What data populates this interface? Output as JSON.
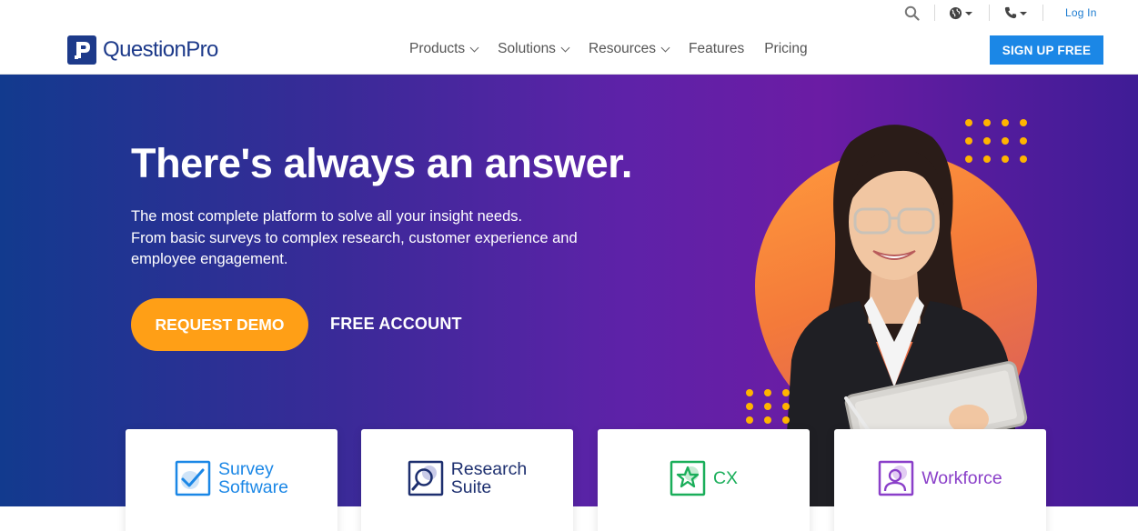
{
  "utility": {
    "search_icon": "search-icon",
    "globe_icon": "globe-icon",
    "phone_icon": "phone-icon",
    "login_label": "Log In"
  },
  "nav": {
    "logo_text": "QuestionPro",
    "menu": [
      {
        "label": "Products"
      },
      {
        "label": "Solutions"
      },
      {
        "label": "Resources"
      },
      {
        "label": "Features"
      },
      {
        "label": "Pricing"
      }
    ],
    "signup_label": "SIGN UP FREE"
  },
  "hero": {
    "title": "There's always an answer.",
    "subtitle_line1": "The most complete platform to solve all your insight needs.",
    "subtitle_line2": "From basic surveys to complex research, customer experience and employee engagement.",
    "cta_primary": "REQUEST DEMO",
    "cta_secondary": "FREE ACCOUNT"
  },
  "cards": [
    {
      "line1": "Survey",
      "line2": "Software",
      "icon": "survey-check-icon",
      "color": "#1b87e6"
    },
    {
      "line1": "Research",
      "line2": "Suite",
      "icon": "research-magnifier-icon",
      "color": "#1d2f6f"
    },
    {
      "line1": "CX",
      "line2": "",
      "icon": "cx-star-icon",
      "color": "#1aae5a"
    },
    {
      "line1": "Workforce",
      "line2": "",
      "icon": "workforce-person-icon",
      "color": "#8a3fc9"
    }
  ],
  "colors": {
    "brand": "#1d3a8a",
    "accent_blue": "#1b87e6",
    "cta_orange": "#ff9f16",
    "dot_yellow": "#ffb400"
  }
}
